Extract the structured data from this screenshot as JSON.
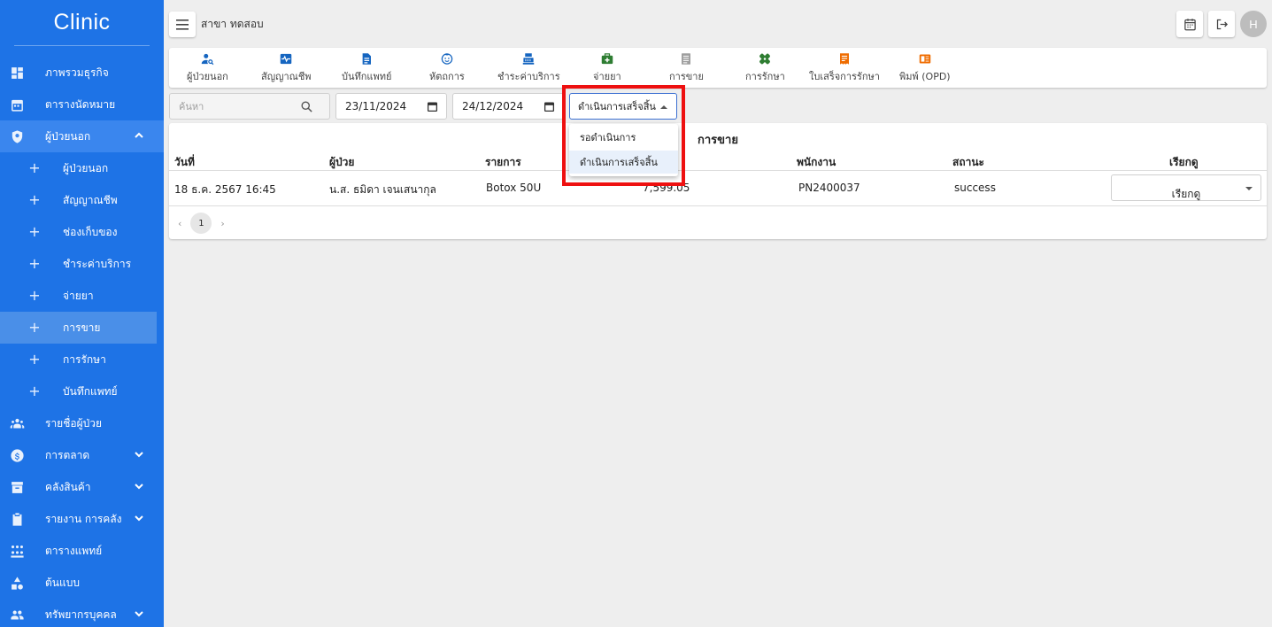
{
  "colors": {
    "sidebar": "#1e73e6",
    "highlight": "#ee1010"
  },
  "sidebar": {
    "brand": "Clinic",
    "items": [
      {
        "label": "ภาพรวมธุรกิจ",
        "icon": "dashboard-icon"
      },
      {
        "label": "ตารางนัดหมาย",
        "icon": "calendar-icon"
      },
      {
        "label": "ผู้ป่วยนอก",
        "icon": "shield-icon",
        "expanded": true
      },
      {
        "label": "รายชื่อผู้ป่วย",
        "icon": "people-icon"
      },
      {
        "label": "การตลาด",
        "icon": "dollar-icon"
      },
      {
        "label": "คลังสินค้า",
        "icon": "archive-icon"
      },
      {
        "label": "รายงาน การคลัง",
        "icon": "clipboard-icon"
      },
      {
        "label": "ตารางแพทย์",
        "icon": "team-icon"
      },
      {
        "label": "ต้นแบบ",
        "icon": "shapes-icon"
      },
      {
        "label": "ทรัพยากรบุคคล",
        "icon": "group-icon"
      }
    ],
    "sub_items": [
      "ผู้ป่วยนอก",
      "สัญญาณชีพ",
      "ช่องเก็บของ",
      "ชำระค่าบริการ",
      "จ่ายยา",
      "การขาย",
      "การรักษา",
      "บันทึกแพทย์"
    ],
    "selected_sub": "การขาย"
  },
  "header": {
    "branch": "สาขา ทดสอบ",
    "avatar_letter": "H"
  },
  "quick_menu": [
    {
      "label": "ผู้ป่วยนอก",
      "icon": "patient-search-icon",
      "color": "#1565c0"
    },
    {
      "label": "สัญญาณชีพ",
      "icon": "vitals-icon",
      "color": "#1565c0"
    },
    {
      "label": "บันทึกแพทย์",
      "icon": "document-icon",
      "color": "#1565c0"
    },
    {
      "label": "หัตถการ",
      "icon": "face-icon",
      "color": "#1565c0"
    },
    {
      "label": "ชำระค่าบริการ",
      "icon": "cash-register-icon",
      "color": "#1565c0"
    },
    {
      "label": "จ่ายยา",
      "icon": "medkit-icon",
      "color": "#2e7d32"
    },
    {
      "label": "การขาย",
      "icon": "list-icon",
      "color": "#9e9e9e"
    },
    {
      "label": "การรักษา",
      "icon": "bandage-icon",
      "color": "#2e7d32"
    },
    {
      "label": "ใบเสร็จการรักษา",
      "icon": "receipt-icon",
      "color": "#ef6c00"
    },
    {
      "label": "พิมพ์ (OPD)",
      "icon": "print-book-icon",
      "color": "#ef6c00"
    }
  ],
  "filters": {
    "search_placeholder": "ค้นหา",
    "date_from": "23/11/2024",
    "date_to": "24/12/2024",
    "status_selected": "ดำเนินการเสร็จสิ้น",
    "status_options": [
      "รอดำเนินการ",
      "ดำเนินการเสร็จสิ้น"
    ]
  },
  "table": {
    "title": "การขาย",
    "headers": [
      "วันที่",
      "ผู้ป่วย",
      "รายการ",
      "",
      "พนักงาน",
      "สถานะ",
      "เรียกดู"
    ],
    "rows": [
      {
        "date": "18 ธ.ค. 2567 16:45",
        "patient": "น.ส. ธมิดา เจนเสนากุล",
        "item": "Botox 50U",
        "amount": "7,599.05",
        "staff": "PN2400037",
        "status": "success",
        "action": "เรียกดู"
      }
    ],
    "page": "1",
    "prev_label": "‹",
    "next_label": "›"
  }
}
